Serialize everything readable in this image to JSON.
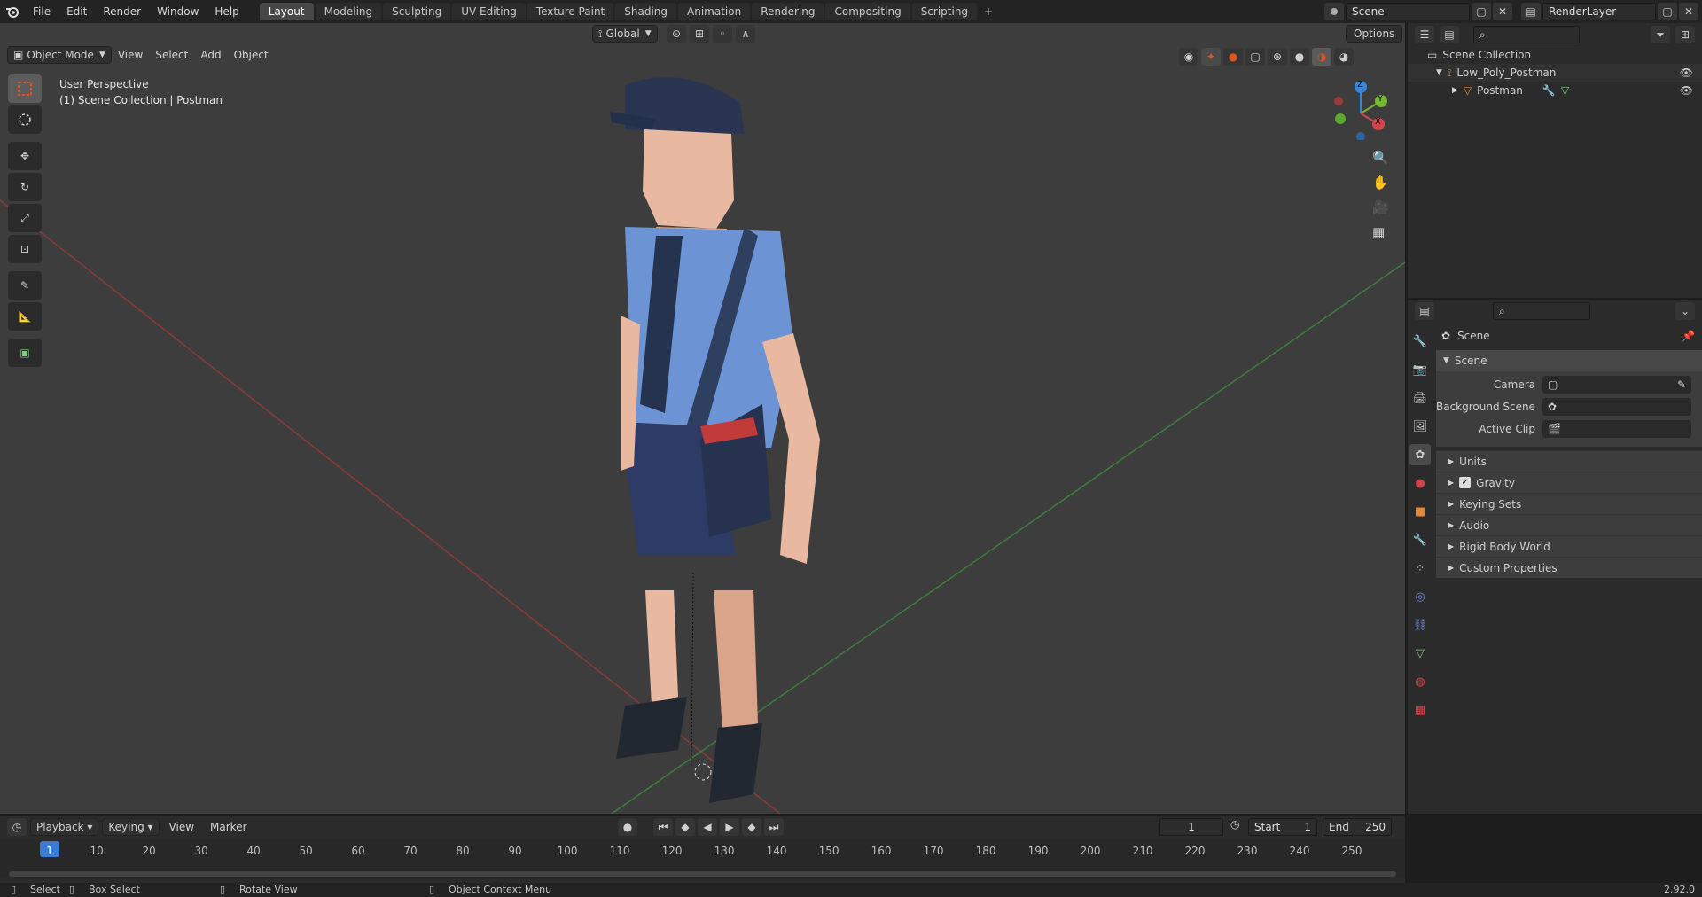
{
  "topbar": {
    "menus": [
      "File",
      "Edit",
      "Render",
      "Window",
      "Help"
    ],
    "workspaces": [
      "Layout",
      "Modeling",
      "Sculpting",
      "UV Editing",
      "Texture Paint",
      "Shading",
      "Animation",
      "Rendering",
      "Compositing",
      "Scripting"
    ],
    "active_workspace": "Layout",
    "scene_name": "Scene",
    "view_layer": "RenderLayer"
  },
  "viewport": {
    "mode": "Object Mode",
    "menus": [
      "View",
      "Select",
      "Add",
      "Object"
    ],
    "orientation": "Global",
    "options_label": "Options",
    "overlay_title": "User Perspective",
    "overlay_subtitle": "(1) Scene Collection | Postman",
    "tools": [
      "select-box",
      "cursor",
      "move",
      "rotate",
      "scale",
      "transform",
      "annotate",
      "measure",
      "add-cube"
    ],
    "gizmo_axes": {
      "z": "Z",
      "y": "Y",
      "x": "X"
    },
    "colors": {
      "x_axis": "#d1464a",
      "y_axis": "#74b734",
      "z_axis": "#3a86d8",
      "active_tool": "#e0541f"
    }
  },
  "outliner": {
    "root": "Scene Collection",
    "collection": "Low_Poly_Postman",
    "object": "Postman"
  },
  "properties": {
    "context": "Scene",
    "panel_title": "Scene",
    "fields": [
      {
        "label": "Camera",
        "value": ""
      },
      {
        "label": "Background Scene",
        "value": ""
      },
      {
        "label": "Active Clip",
        "value": ""
      }
    ],
    "subpanels": [
      "Units",
      "Gravity",
      "Keying Sets",
      "Audio",
      "Rigid Body World",
      "Custom Properties"
    ],
    "gravity_checked": true
  },
  "timeline": {
    "menus": [
      "Playback",
      "Keying",
      "View",
      "Marker"
    ],
    "current_frame": "1",
    "start_label": "Start",
    "start": "1",
    "end_label": "End",
    "end": "250",
    "ticks": [
      "1",
      "10",
      "20",
      "30",
      "40",
      "50",
      "60",
      "70",
      "80",
      "90",
      "100",
      "110",
      "120",
      "130",
      "140",
      "150",
      "160",
      "170",
      "180",
      "190",
      "200",
      "210",
      "220",
      "230",
      "240",
      "250"
    ]
  },
  "statusbar": {
    "select": "Select",
    "box_select": "Box Select",
    "rotate_view": "Rotate View",
    "context_menu": "Object Context Menu",
    "version": "2.92.0"
  }
}
